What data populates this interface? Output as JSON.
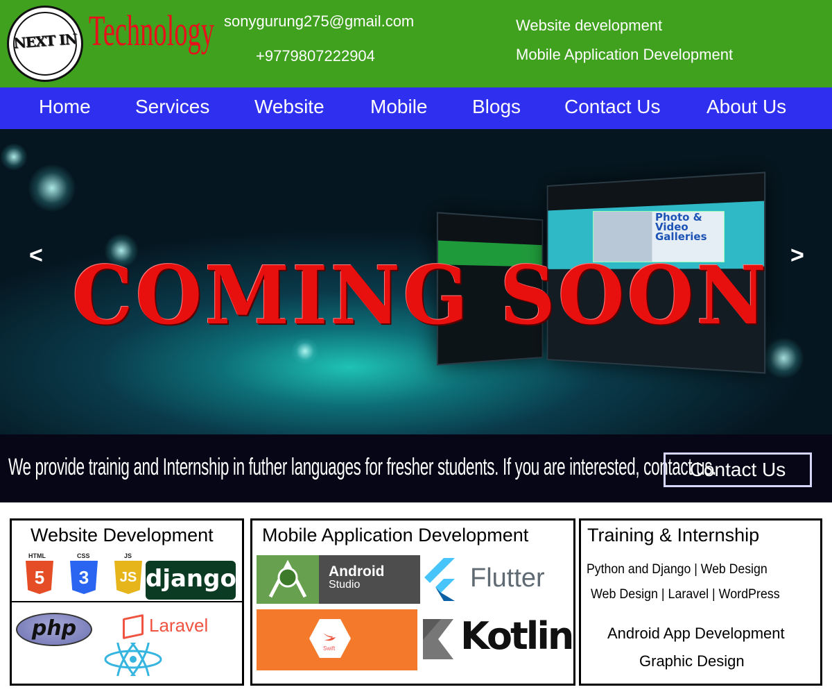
{
  "header": {
    "logo_circle_text": "NEXT IN",
    "logo_word": "Technology",
    "email": "sonygurung275@gmail.com",
    "phone": "+9779807222904",
    "services": [
      "Website development",
      "Mobile Application Development"
    ]
  },
  "nav": {
    "items": [
      "Home",
      "Services",
      "Website",
      "Mobile",
      "Blogs",
      "Contact Us",
      "About Us"
    ]
  },
  "hero": {
    "headline": "COMING SOON",
    "prev_arrow": "<",
    "next_arrow": ">",
    "screen_caption": "Photo & Video Galleries"
  },
  "banner": {
    "text": "We provide trainig and Internship in futher languages for fresher students. If you are interested, contact us.",
    "button": "Contact Us"
  },
  "website_box": {
    "title": "Website Development",
    "html_label": "HTML",
    "html_digit": "5",
    "css_label": "CSS",
    "css_digit": "3",
    "js_label": "JS",
    "js_digit": "JS",
    "django": "django",
    "php": "php",
    "laravel": "Laravel"
  },
  "mobile_box": {
    "title": "Mobile Application Development",
    "android_name": "Android",
    "android_sub": "Studio",
    "flutter": "Flutter",
    "swift": "Swift",
    "kotlin": "Kotlin"
  },
  "training_box": {
    "title": "Training & Internship",
    "line1": "Python and Django |  Web Design",
    "line2": "Web Design | Laravel | WordPress",
    "line3": "Android App Development",
    "line4": "Graphic Design"
  },
  "colors": {
    "header_green": "#3fa11e",
    "nav_blue": "#2f2fef",
    "headline_red": "#e80f0f",
    "banner_bg": "#060616"
  }
}
